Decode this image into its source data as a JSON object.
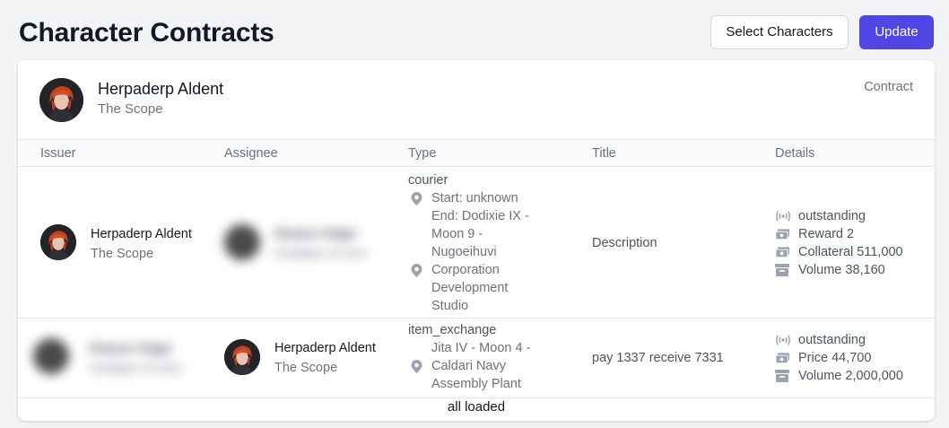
{
  "header": {
    "title": "Character Contracts",
    "select_label": "Select Characters",
    "update_label": "Update"
  },
  "character": {
    "name": "Herpaderp Aldent",
    "corp": "The Scope",
    "tag": "Contract"
  },
  "table": {
    "columns": [
      "Issuer",
      "Assignee",
      "Type",
      "Title",
      "Details"
    ],
    "rows": [
      {
        "issuer": {
          "name": "Herpaderp Aldent",
          "corp": "The Scope"
        },
        "assignee": {
          "name": "Eleanor Edger",
          "corp": "Goddam of Giro",
          "blurred": true
        },
        "type": "courier",
        "start": "Start: unknown",
        "end_lines": [
          "End: Dodixie IX -",
          "Moon 9 -",
          "Nugoeihuvi",
          "Corporation",
          "Development",
          "Studio"
        ],
        "title": "Description",
        "details": [
          "outstanding",
          "Reward 2",
          "Collateral 511,000",
          "Volume 38,160"
        ]
      },
      {
        "issuer": {
          "name": "Eleanor Edger",
          "corp": "Goddam of Giro",
          "blurred": true
        },
        "assignee": {
          "name": "Herpaderp Aldent",
          "corp": "The Scope"
        },
        "type": "item_exchange",
        "start_lines": [
          "Jita IV - Moon 4 -",
          "Caldari Navy",
          "Assembly Plant"
        ],
        "title": "pay 1337 receive 7331",
        "details": [
          "outstanding",
          "Price 44,700",
          "Volume 2,000,000"
        ]
      }
    ]
  },
  "footer": {
    "status": "all loaded"
  },
  "icons": {
    "status": "broadcast-icon",
    "money": "cash-icon",
    "volume": "archive-box-icon",
    "location": "map-pin-icon"
  },
  "colors": {
    "accent": "#4f46e5",
    "text_muted": "#6b7280",
    "border": "#e5e7eb"
  }
}
